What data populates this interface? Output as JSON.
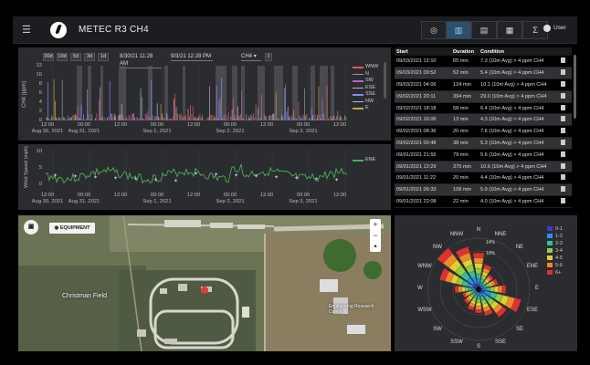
{
  "app": {
    "title": "METEC R3 CH4",
    "user": "User"
  },
  "toolbar": [
    {
      "label": "◎",
      "name": "toolbar-overview-button",
      "active": false
    },
    {
      "label": "▥",
      "name": "toolbar-dashboard-button",
      "active": true
    },
    {
      "label": "▤",
      "name": "toolbar-reports-button",
      "active": false
    },
    {
      "label": "▦",
      "name": "toolbar-table-button",
      "active": false
    },
    {
      "label": "Σ",
      "name": "toolbar-stats-button",
      "active": false
    }
  ],
  "controls": {
    "ranges": [
      "30d",
      "10d",
      "5d",
      "3d",
      "1d"
    ],
    "start_date": "8/30/21 11:28 AM",
    "end_date": "9/3/21 12:28 PM",
    "gas": "CH4",
    "gas_caret": "▾"
  },
  "ch4_chart": {
    "ylabel": "CH4 (ppm)",
    "yticks": [
      "12",
      "10",
      "8",
      "6",
      "4",
      "2",
      "0"
    ],
    "legend": [
      {
        "name": "WNW",
        "color": "#e05a5a"
      },
      {
        "name": "N",
        "color": "#9a9a9a"
      },
      {
        "name": "SW",
        "color": "#c060c0"
      },
      {
        "name": "ESE",
        "color": "#e0a0c8"
      },
      {
        "name": "SSE",
        "color": "#8888ff"
      },
      {
        "name": "NW",
        "color": "#a0c0e0"
      },
      {
        "name": "E",
        "color": "#d0a040"
      }
    ]
  },
  "wind_chart": {
    "ylabel": "Wind Speed (mph)",
    "yticks": [
      "10",
      "5",
      "0"
    ],
    "legend": [
      {
        "name": "ENE",
        "color": "#4caf50"
      }
    ]
  },
  "x_axis": [
    {
      "time": "12:00",
      "date": "Aug 30, 2021"
    },
    {
      "time": "00:00",
      "date": "Aug 31, 2021"
    },
    {
      "time": "12:00",
      "date": ""
    },
    {
      "time": "00:00",
      "date": "Sep 1, 2021"
    },
    {
      "time": "12:00",
      "date": ""
    },
    {
      "time": "00:00",
      "date": "Sep 2, 2021"
    },
    {
      "time": "12:00",
      "date": ""
    },
    {
      "time": "00:00",
      "date": "Sep 3, 2021"
    },
    {
      "time": "12:00",
      "date": ""
    }
  ],
  "events": {
    "headers": [
      "Start",
      "Duration",
      "Condition"
    ],
    "rows": [
      [
        "09/03/2021 12:10",
        "65 min",
        "7.3 (10m Avg) > 4 ppm CH4"
      ],
      [
        "09/03/2021 09:52",
        "52 min",
        "5.4 (10m Avg) > 4 ppm CH4"
      ],
      [
        "09/03/2021 04:06",
        "124 min",
        "10.1 (10m Avg) > 4 ppm CH4"
      ],
      [
        "09/02/2021 20:11",
        "394 min",
        "29.0 (10m Avg) > 4 ppm CH4"
      ],
      [
        "09/02/2021 18:18",
        "58 min",
        "6.4 (10m Avg) > 4 ppm CH4"
      ],
      [
        "09/02/2021 16:06",
        "13 min",
        "4.3 (10m Avg) > 4 ppm CH4"
      ],
      [
        "09/02/2021 08:36",
        "20 min",
        "7.6 (10m Avg) > 4 ppm CH4"
      ],
      [
        "09/02/2021 00:48",
        "38 min",
        "5.3 (10m Avg) > 4 ppm CH4"
      ],
      [
        "09/01/2021 21:55",
        "79 min",
        "5.6 (10m Avg) > 4 ppm CH4"
      ],
      [
        "09/01/2021 13:29",
        "375 min",
        "10.6 (10m Avg) > 4 ppm CH4"
      ],
      [
        "09/01/2021 11:22",
        "20 min",
        "4.4 (10m Avg) > 4 ppm CH4"
      ],
      [
        "09/01/2021 06:33",
        "108 min",
        "5.9 (10m Avg) > 4 ppm CH4"
      ],
      [
        "09/01/2021 22:08",
        "22 min",
        "4.0 (10m Avg) > 4 ppm CH4"
      ]
    ]
  },
  "map": {
    "equipment_label": "EQUIPMENT",
    "zoom_in": "+",
    "zoom_out": "−",
    "labels": [
      "Christman Field",
      "Engineering Research Center"
    ]
  },
  "rose": {
    "directions": [
      "N",
      "NNE",
      "NE",
      "ENE",
      "E",
      "ESE",
      "SE",
      "SSE",
      "S",
      "SSW",
      "SW",
      "WSW",
      "W",
      "WNW",
      "NW",
      "NNW"
    ],
    "ring_labels": [
      "14%",
      "10%"
    ],
    "legend": [
      {
        "label": "0-1",
        "color": "#3b3bd6"
      },
      {
        "label": "1-2",
        "color": "#2f8fe0"
      },
      {
        "label": "2-3",
        "color": "#2fc0a0"
      },
      {
        "label": "3-4",
        "color": "#8fd040"
      },
      {
        "label": "4-5",
        "color": "#e0d030"
      },
      {
        "label": "5-6",
        "color": "#f08a2a"
      },
      {
        "label": "6+",
        "color": "#e03030"
      }
    ]
  }
}
